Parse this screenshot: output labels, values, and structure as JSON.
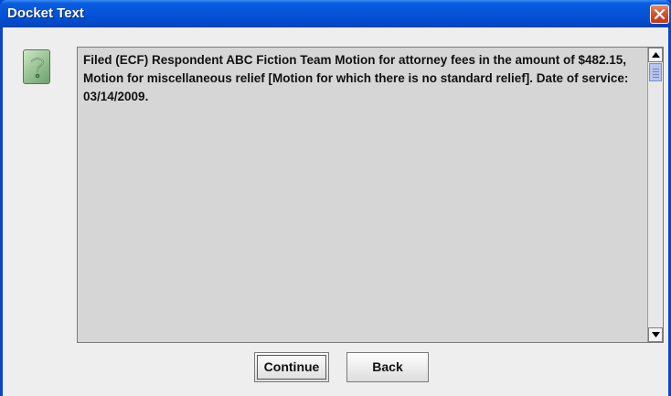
{
  "window": {
    "title": "Docket Text"
  },
  "icons": {
    "dialog_icon": "question-icon",
    "close_icon": "close-icon",
    "scroll_up": "arrow-up-icon",
    "scroll_down": "arrow-down-icon"
  },
  "docket": {
    "text": "Filed (ECF) Respondent ABC Fiction Team Motion for attorney fees in the amount of $482.15, Motion for miscellaneous relief [Motion for which there is no standard relief]. Date of service: 03/14/2009."
  },
  "buttons": {
    "continue_label": "Continue",
    "back_label": "Back"
  },
  "colors": {
    "titlebar": "#0553d8",
    "client_bg": "#eeeeee",
    "text_area_bg": "#d6d6d6",
    "close_button": "#d9512e"
  }
}
